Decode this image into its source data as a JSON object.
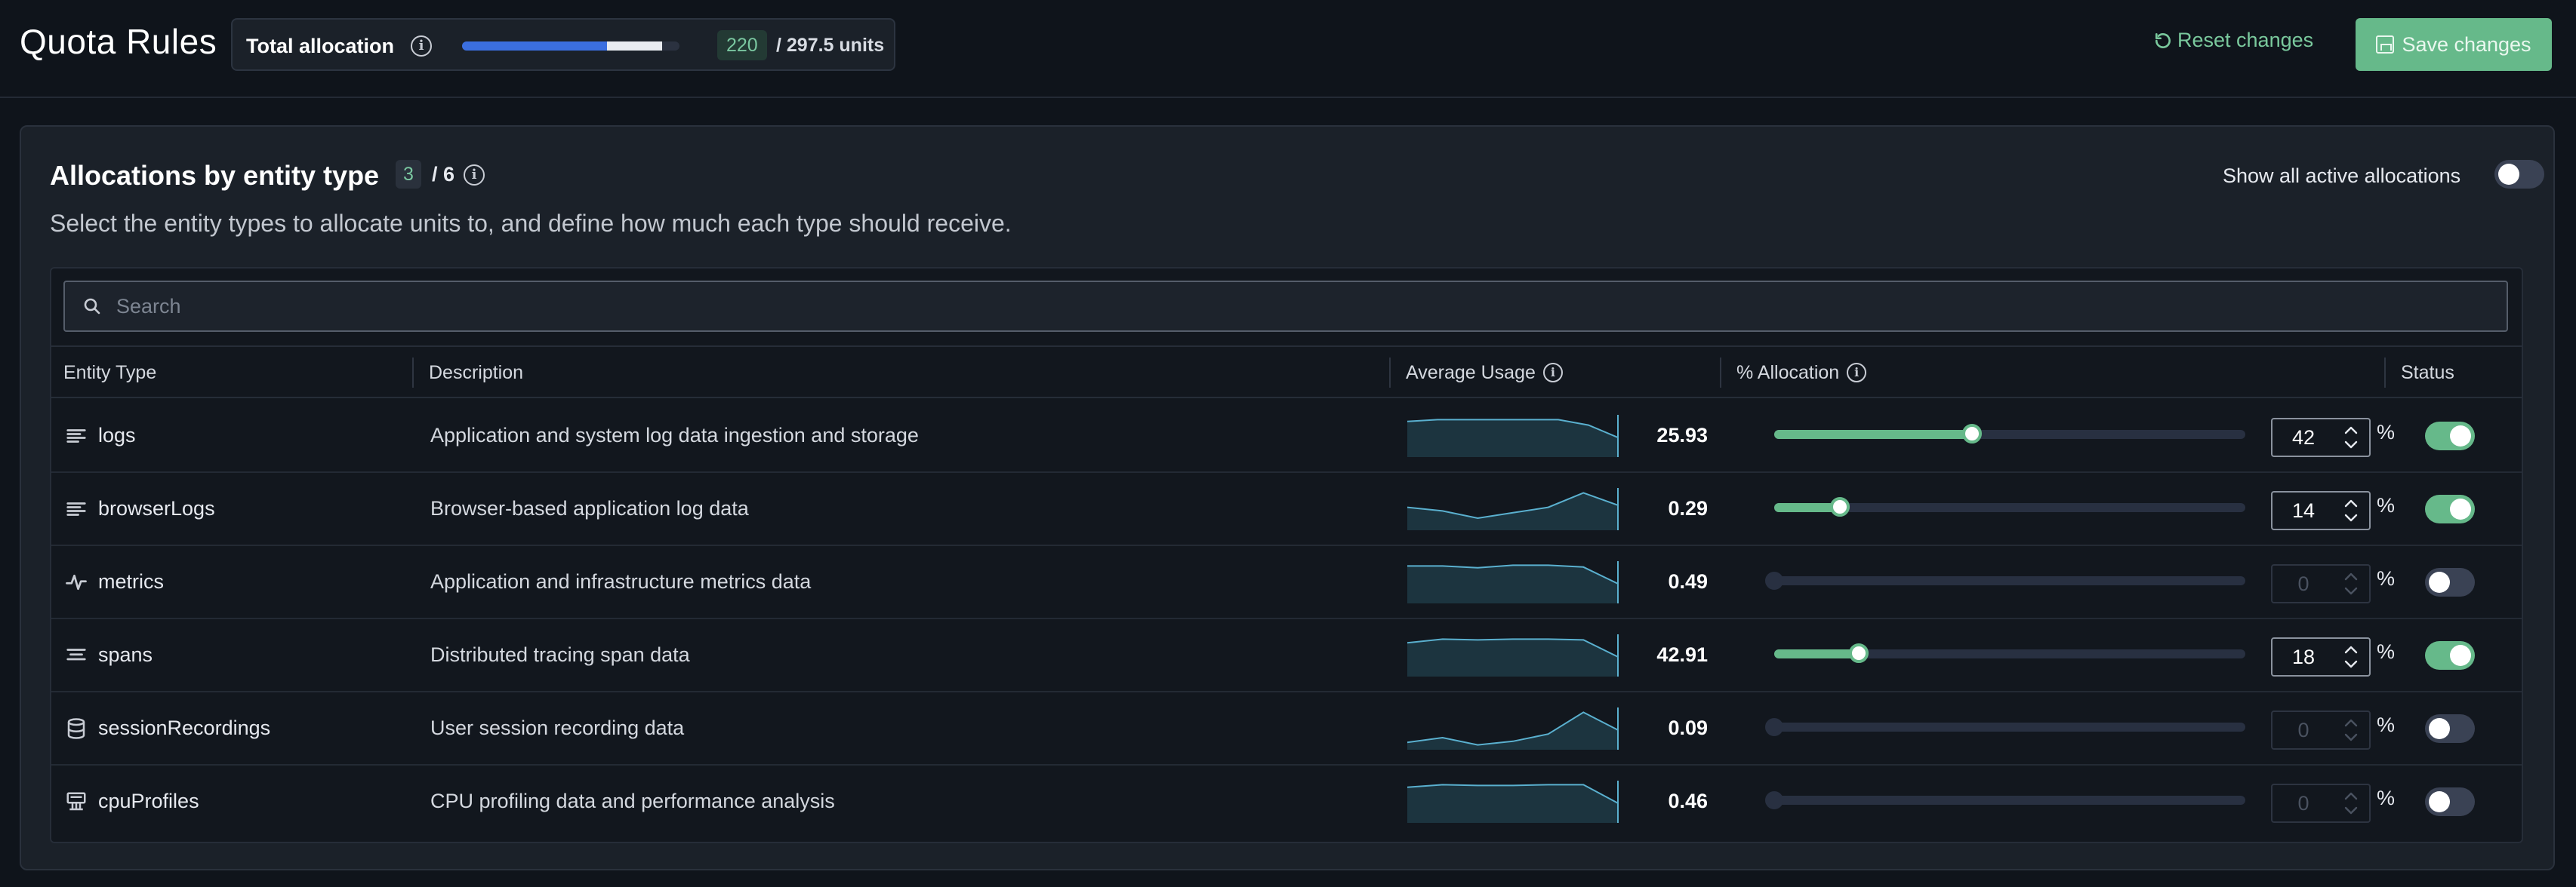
{
  "header": {
    "title": "Quota Rules",
    "total_allocation_label": "Total allocation",
    "allocated_value": "220",
    "allocation_total": "/ 297.5 units",
    "allocation_progress": 0.74,
    "reset_label": "Reset changes",
    "save_label": "Save changes"
  },
  "card": {
    "title": "Allocations by entity type",
    "selected_count": "3",
    "total_count": "/ 6",
    "subtitle": "Select the entity types to allocate units to, and define how much each type should receive.",
    "show_all_label": "Show all active allocations",
    "show_all_on": false
  },
  "search": {
    "placeholder": "Search"
  },
  "columns": {
    "entity_type": "Entity Type",
    "description": "Description",
    "average_usage": "Average Usage",
    "allocation": "% Allocation",
    "status": "Status"
  },
  "colors": {
    "accent_green": "#66b98a",
    "progress_blue": "#3b6fe0",
    "sparkline": "#5ab0cf"
  },
  "rows": [
    {
      "icon": "lines-icon",
      "type": "logs",
      "description": "Application and system log data ingestion and storage",
      "usage": "25.93",
      "allocation": "42",
      "enabled": true,
      "sparkline": [
        0.9,
        0.95,
        0.95,
        0.95,
        0.95,
        0.95,
        0.8,
        0.45
      ]
    },
    {
      "icon": "lines-icon",
      "type": "browserLogs",
      "description": "Browser-based application log data",
      "usage": "0.29",
      "allocation": "14",
      "enabled": true,
      "sparkline": [
        0.55,
        0.45,
        0.25,
        0.4,
        0.55,
        0.95,
        0.6
      ]
    },
    {
      "icon": "pulse-icon",
      "type": "metrics",
      "description": "Application and infrastructure metrics data",
      "usage": "0.49",
      "allocation": "0",
      "enabled": false,
      "sparkline": [
        0.95,
        0.95,
        0.9,
        0.97,
        0.97,
        0.92,
        0.45
      ]
    },
    {
      "icon": "filter-lines-icon",
      "type": "spans",
      "description": "Distributed tracing span data",
      "usage": "42.91",
      "allocation": "18",
      "enabled": true,
      "sparkline": [
        0.85,
        0.95,
        0.93,
        0.95,
        0.95,
        0.93,
        0.45
      ]
    },
    {
      "icon": "database-icon",
      "type": "sessionRecordings",
      "description": "User session recording data",
      "usage": "0.09",
      "allocation": "0",
      "enabled": false,
      "sparkline": [
        0.12,
        0.25,
        0.05,
        0.15,
        0.35,
        0.95,
        0.45
      ]
    },
    {
      "icon": "cpu-icon",
      "type": "cpuProfiles",
      "description": "CPU profiling data and performance analysis",
      "usage": "0.46",
      "allocation": "0",
      "enabled": false,
      "sparkline": [
        0.9,
        0.97,
        0.95,
        0.95,
        0.97,
        0.97,
        0.45
      ]
    }
  ]
}
